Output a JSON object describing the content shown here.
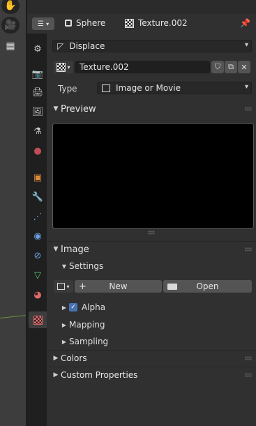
{
  "header": {
    "object_name": "Sphere",
    "texture_name": "Texture.002"
  },
  "texture_user": {
    "label": "Displace"
  },
  "datablock": {
    "name": "Texture.002"
  },
  "type_row": {
    "label": "Type",
    "value": "Image or Movie"
  },
  "sections": {
    "preview": "Preview",
    "image": "Image",
    "settings": "Settings",
    "alpha": "Alpha",
    "mapping": "Mapping",
    "sampling": "Sampling",
    "colors": "Colors",
    "custom_properties": "Custom Properties"
  },
  "image_buttons": {
    "new": "New",
    "open": "Open"
  },
  "icons": {
    "tool": [
      "hand-icon",
      "camera-icon",
      "grid-icon"
    ],
    "tabs": [
      "tool-icon",
      "render-icon",
      "output-icon",
      "view-layer-icon",
      "scene-icon",
      "world-icon",
      "object-icon",
      "modifier-icon",
      "particles-icon",
      "physics-icon",
      "constraints-icon",
      "data-icon",
      "material-icon",
      "texture-icon"
    ]
  },
  "colors": {
    "accent": "#4772b3",
    "panel_bg": "#303030",
    "tab_bg": "#1f1f1f"
  }
}
